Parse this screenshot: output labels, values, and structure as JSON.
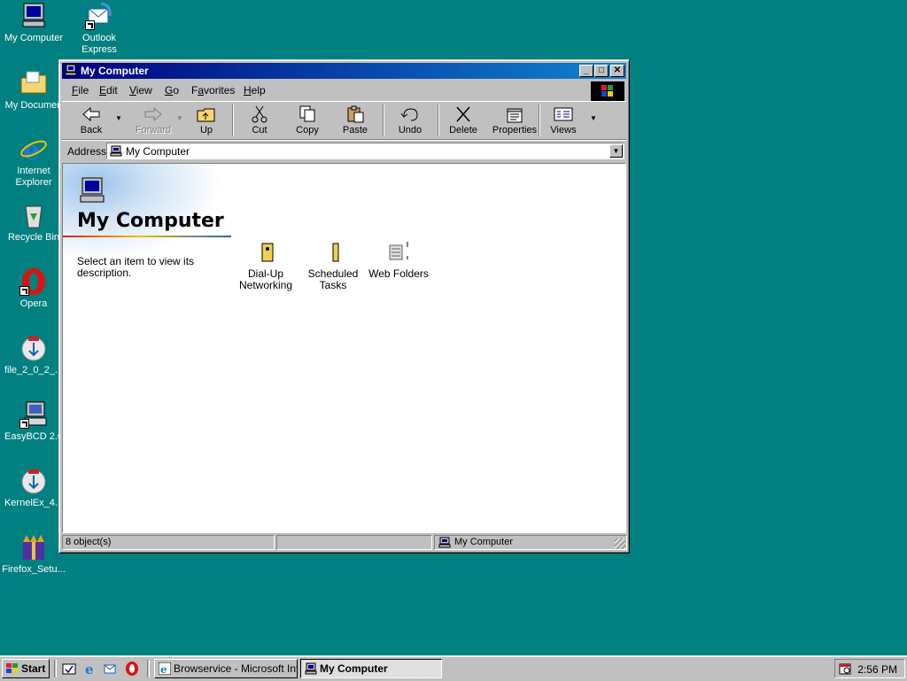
{
  "desktop": {
    "icons": [
      {
        "label": "My Computer",
        "icon": "my-computer-icon"
      },
      {
        "label": "Outlook\nExpress",
        "icon": "outlook-express-icon"
      },
      {
        "label": "My Documen",
        "icon": "my-documents-folder-icon"
      },
      {
        "label": "Internet\nExplorer",
        "icon": "internet-explorer-icon"
      },
      {
        "label": "Recycle Bin",
        "icon": "recycle-bin-icon"
      },
      {
        "label": "Opera",
        "icon": "opera-icon"
      },
      {
        "label": "file_2_0_2_...",
        "icon": "installer-icon"
      },
      {
        "label": "EasyBCD 2.0",
        "icon": "easybcd-icon"
      },
      {
        "label": "KernelEx_4...",
        "icon": "installer-icon"
      },
      {
        "label": "Firefox_Setu...",
        "icon": "firefox-setup-icon"
      }
    ]
  },
  "window": {
    "title": "My Computer",
    "menu": [
      "File",
      "Edit",
      "View",
      "Go",
      "Favorites",
      "Help"
    ],
    "menu_accel": [
      "F",
      "E",
      "V",
      "G",
      "a",
      "H"
    ],
    "toolbar": {
      "back": "Back",
      "forward": "Forward",
      "up": "Up",
      "cut": "Cut",
      "copy": "Copy",
      "paste": "Paste",
      "undo": "Undo",
      "delete": "Delete",
      "properties": "Properties",
      "views": "Views"
    },
    "address": {
      "label": "Address",
      "value": "My Computer"
    },
    "pane": {
      "title": "My Computer",
      "description": "Select an item to view its description."
    },
    "items": [
      {
        "label": "Dial-Up\nNetworking",
        "icon": "dial-up-networking-icon"
      },
      {
        "label": "Scheduled\nTasks",
        "icon": "scheduled-tasks-icon"
      },
      {
        "label": "Web Folders",
        "icon": "web-folders-icon"
      }
    ],
    "status": {
      "count": "8 object(s)",
      "location": "My Computer"
    }
  },
  "taskbar": {
    "start": "Start",
    "quick_launch": [
      "show-desktop-icon",
      "internet-explorer-icon",
      "outlook-express-icon",
      "opera-icon"
    ],
    "tasks": [
      {
        "label": "Browservice - Microsoft Int...",
        "active": false
      },
      {
        "label": "My Computer",
        "active": true
      }
    ],
    "clock": "2:56 PM"
  },
  "colors": {
    "desktop": "#008080",
    "title_start": "#000080",
    "title_end": "#1084d0",
    "face": "#c0c0c0"
  }
}
